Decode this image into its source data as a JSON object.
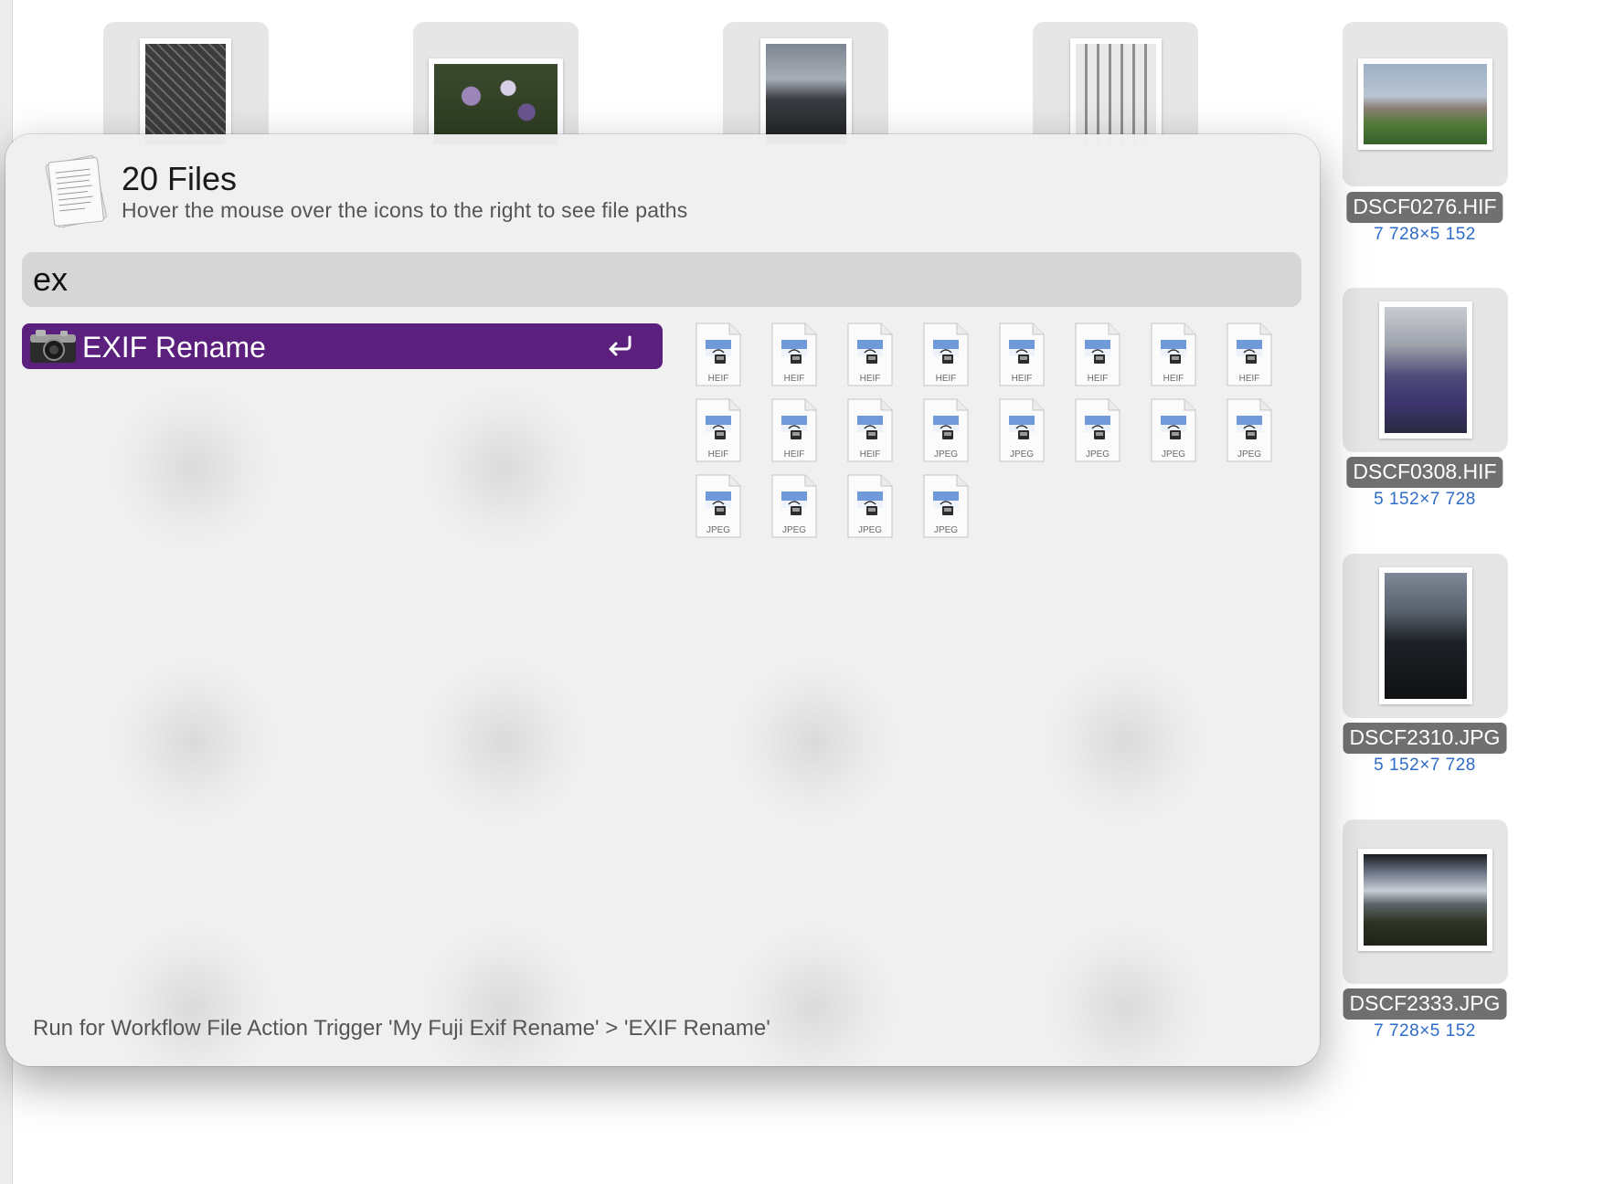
{
  "background": {
    "top_row_count": 4,
    "right_column": [
      {
        "filename": "DSCF0276.HIF",
        "dimensions": "7 728×5 152"
      },
      {
        "filename": "DSCF0308.HIF",
        "dimensions": "5 152×7 728"
      },
      {
        "filename": "DSCF2310.JPG",
        "dimensions": "5 152×7 728"
      },
      {
        "filename": "DSCF2333.JPG",
        "dimensions": "7 728×5 152"
      }
    ]
  },
  "panel": {
    "title": "20 Files",
    "subtitle": "Hover the mouse over the icons to the right to see file paths",
    "search": {
      "value": "ex"
    },
    "result": {
      "label": "EXIF Rename",
      "icon": "camera-icon",
      "action_icon": "return-icon"
    },
    "file_icons": [
      "HEIF",
      "HEIF",
      "HEIF",
      "HEIF",
      "HEIF",
      "HEIF",
      "HEIF",
      "HEIF",
      "HEIF",
      "HEIF",
      "HEIF",
      "JPEG",
      "JPEG",
      "JPEG",
      "JPEG",
      "JPEG",
      "JPEG",
      "JPEG",
      "JPEG",
      "JPEG"
    ],
    "footer": "Run for Workflow File Action Trigger 'My Fuji Exif Rename' > 'EXIF Rename'"
  },
  "colors": {
    "accent": "#5b1f7e",
    "dimension_text": "#2d6cc8",
    "filename_badge": "#707070"
  }
}
